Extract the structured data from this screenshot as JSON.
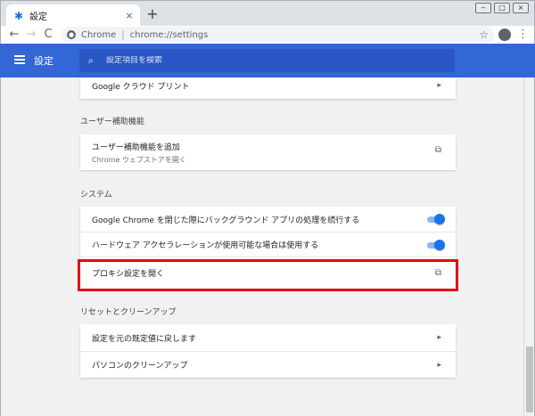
{
  "window": {
    "tab_title": "設定",
    "tab_close": "×",
    "new_tab": "+",
    "controls": [
      "‒",
      "□",
      "×"
    ]
  },
  "toolbar": {
    "back": "←",
    "forward": "→",
    "reload": "C",
    "scheme": "Chrome",
    "separator": "|",
    "url": "chrome://settings",
    "star": "☆",
    "menu": "⋮"
  },
  "header": {
    "title": "設定",
    "search_placeholder": "設定項目を検索"
  },
  "sections": {
    "printing": {
      "items": [
        {
          "label": "Google クラウド プリント",
          "action": "arrow"
        }
      ]
    },
    "accessibility": {
      "title": "ユーザー補助機能",
      "items": [
        {
          "label": "ユーザー補助機能を追加",
          "sublabel": "Chrome ウェブストアを開く",
          "action": "external"
        }
      ]
    },
    "system": {
      "title": "システム",
      "items": [
        {
          "label": "Google Chrome を閉じた際にバックグラウンド アプリの処理を続行する",
          "action": "toggle",
          "checked": true
        },
        {
          "label": "ハードウェア アクセラレーションが使用可能な場合は使用する",
          "action": "toggle",
          "checked": true
        },
        {
          "label": "プロキシ設定を開く",
          "action": "external"
        }
      ]
    },
    "reset": {
      "title": "リセットとクリーンアップ",
      "items": [
        {
          "label": "設定を元の既定値に戻します",
          "action": "arrow"
        },
        {
          "label": "パソコンのクリーンアップ",
          "action": "arrow"
        }
      ]
    }
  },
  "glyphs": {
    "arrow": "▸",
    "external": "⧉"
  },
  "colors": {
    "header_bg": "#3367d6",
    "search_bg": "#2a56c6",
    "toggle_on": "#1a73e8",
    "highlight": "#e60012"
  }
}
